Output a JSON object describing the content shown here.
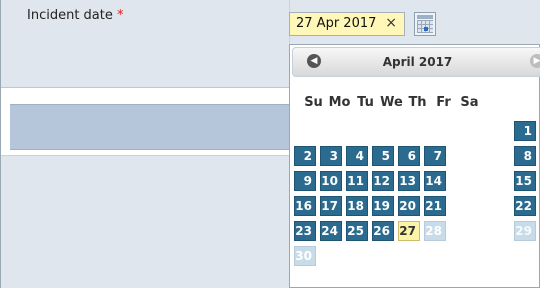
{
  "form": {
    "label": "Incident date",
    "required_mark": "*"
  },
  "date_input": {
    "value": "27 Apr 2017",
    "clear": "×"
  },
  "calendar": {
    "month_label": "April 2017",
    "dow": [
      "Su",
      "Mo",
      "Tu",
      "We",
      "Th",
      "Fr",
      "Sa"
    ],
    "days": {
      "r1": [
        "1"
      ],
      "r2": [
        "2",
        "3",
        "4",
        "5",
        "6",
        "7",
        "8"
      ],
      "r3": [
        "9",
        "10",
        "11",
        "12",
        "13",
        "14",
        "15"
      ],
      "r4": [
        "16",
        "17",
        "18",
        "19",
        "20",
        "21",
        "22"
      ],
      "r5": [
        "23",
        "24",
        "25",
        "26",
        "27",
        "28",
        "29"
      ],
      "r6": [
        "30"
      ]
    },
    "selected_day": "27",
    "colors": {
      "day": "#2a6b8f",
      "selected": "#fbf4a6",
      "disabled": "#c8dbe8"
    }
  }
}
